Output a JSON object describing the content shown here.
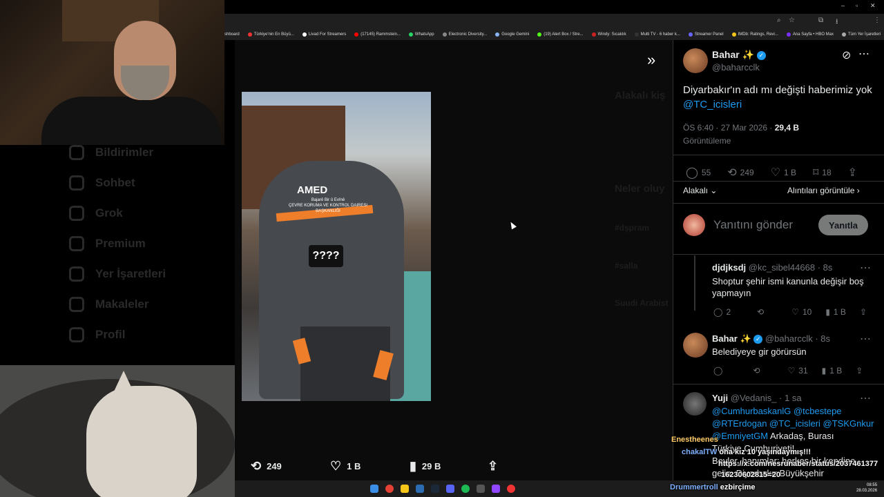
{
  "browser": {
    "bookmarks": [
      "shboard",
      "Türkiye'nin En Büyü...",
      "Livad For Streamers",
      "(17145) Rammstein...",
      "WhatsApp",
      "Electronic Diversity...",
      "Google Gemini",
      "(19) Alert Box / Stre...",
      "Windy: Sıcaklık",
      "Multi TV - 6 haber k...",
      "Streamer Panel",
      "IMDb: Ratings, Revi...",
      "Ana Sayfa • HBO Max",
      "Tüm Yer İşaretleri"
    ]
  },
  "sidebar_faded": {
    "items": [
      "Bildirimler",
      "Sohbet",
      "Grok",
      "Premium",
      "Yer İşaretleri",
      "Makaleler",
      "Profil"
    ]
  },
  "viewer": {
    "photo_text": {
      "brand": "AMED",
      "tagline": "Bajarê Bir û Evînê",
      "dept": "ÇEVRE KORUMA VE KONTROL DAIRESI BAŞKANLIĞI",
      "censor": "????"
    },
    "actions": {
      "retweets": "249",
      "likes": "1 B",
      "views": "29 B"
    }
  },
  "faded_right": {
    "heading": "Alakalı kiş",
    "trends_heading": "Neler oluy",
    "trend1": "#dşpram",
    "trend2": "#salla",
    "trend3": "Suudi Arabist"
  },
  "tweet": {
    "author_name": "Bahar ✨",
    "author_handle": "@baharcclk",
    "text_main": "Diyarbakır'ın adı mı değişti haberimiz yok ",
    "text_mention": "@TC_icisleri",
    "time": "ÖS 6:40 · 27 Mar 2026 · ",
    "views_count": "29,4 B",
    "views_label": "Görüntüleme",
    "stats": {
      "replies": "55",
      "retweets": "249",
      "likes": "1 B",
      "bookmarks": "18"
    },
    "relevant_label": "Alakalı",
    "quotes_label": "Alıntıları görüntüle",
    "reply_placeholder": "Yanıtını gönder",
    "reply_button": "Yanıtla"
  },
  "replies": [
    {
      "name": "djdjksdj",
      "meta": "@kc_sibel44668 · 8s",
      "text": "Shoptur şehir ismi kanunla değişir boş yapmayın",
      "stats": {
        "replies": "2",
        "retweets": "",
        "likes": "10",
        "views": "1 B"
      }
    },
    {
      "name": "Bahar ✨",
      "meta": "@baharcclk · 8s",
      "text": "Belediyeye gir görürsün",
      "stats": {
        "replies": "",
        "retweets": "",
        "likes": "31",
        "views": "1 B"
      }
    },
    {
      "name": "Yuji",
      "meta": "@Vedanis_ · 1 sa",
      "mentions1": "@CumhurbaskanlG @tcbestepe",
      "mentions2": "@RTErdogan @TC_icisleri @TSKGnkur",
      "mentions3": "@EmniyetGM",
      "text1": "Arkadaş, Burası",
      "text2": "Türkiye Cumhuriyeti!",
      "text3": "Beyler, hanımlar: herkes bir kendine",
      "text4": "gelin. Diyarbakır Büyükşehir"
    }
  ],
  "chat": [
    {
      "user": "Enestheenes",
      "msg": ""
    },
    {
      "user": "chakalTW",
      "msg": "öha kız 10 yaşındaymış!!!"
    },
    {
      "user": "",
      "msg": "https://x.com/nesrunaber/status/2037461377"
    },
    {
      "user": "",
      "msg": "16230602815=20"
    },
    {
      "user": "Drummertroll",
      "msg": "ezbirçime"
    }
  ],
  "taskbar": {
    "time": "08:55",
    "date": "28.03.2026"
  },
  "colors": {
    "accent": "#1d9bf0",
    "background": "#000000",
    "orange": "#ef7e2b"
  }
}
